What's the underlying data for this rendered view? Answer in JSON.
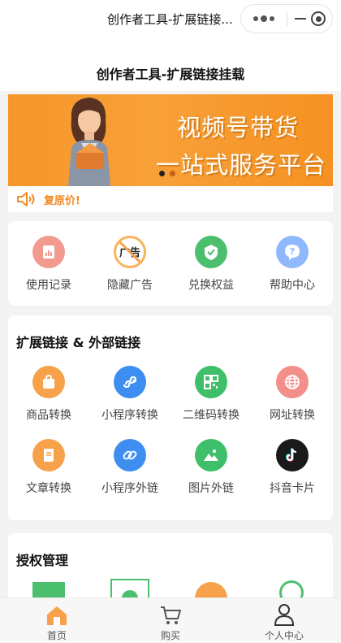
{
  "window": {
    "app_title": "创作者工具-扩展链接...",
    "capsule": {
      "more_icon": "more-dots-icon",
      "close_icon": "close-miniapp-icon"
    }
  },
  "navbar": {
    "title": "创作者工具-扩展链接挂载"
  },
  "banner": {
    "line1": "视频号带货",
    "line2": "一站式服务平台",
    "slides": 2,
    "active_slide": 0,
    "color": "#f6962a"
  },
  "notice": {
    "icon": "speaker-icon",
    "text": "复原价!"
  },
  "quick_menu": [
    {
      "label": "使用记录",
      "icon": "record-icon",
      "color": "#f19a8e"
    },
    {
      "label": "隐藏广告",
      "icon": "no-ads-icon",
      "color": "#f7b45a"
    },
    {
      "label": "兑换权益",
      "icon": "exchange-icon",
      "color": "#4cbf6e"
    },
    {
      "label": "帮助中心",
      "icon": "help-icon",
      "color": "#8fb8ff"
    }
  ],
  "links_section": {
    "title": "扩展链接 & 外部链接",
    "items": [
      {
        "label": "商品转换",
        "icon": "shopping-bag-icon",
        "color": "#f7a14a"
      },
      {
        "label": "小程序转换",
        "icon": "miniprogram-icon",
        "color": "#3d8ef0"
      },
      {
        "label": "二维码转换",
        "icon": "qrcode-icon",
        "color": "#3fbf6a"
      },
      {
        "label": "网址转换",
        "icon": "globe-icon",
        "color": "#f28f8a"
      },
      {
        "label": "文章转换",
        "icon": "article-icon",
        "color": "#f7a14a"
      },
      {
        "label": "小程序外链",
        "icon": "link-icon",
        "color": "#3d8ef0"
      },
      {
        "label": "图片外链",
        "icon": "image-icon",
        "color": "#3fbf6a"
      },
      {
        "label": "抖音卡片",
        "icon": "tiktok-icon",
        "color": "#1a1a1a"
      }
    ]
  },
  "auth_section": {
    "title": "授权管理"
  },
  "tabbar": {
    "items": [
      {
        "label": "首页",
        "icon": "home-icon",
        "active": true
      },
      {
        "label": "购买",
        "icon": "cart-icon",
        "active": false
      },
      {
        "label": "个人中心",
        "icon": "user-icon",
        "active": false
      }
    ],
    "active_color": "#f7a14a"
  }
}
